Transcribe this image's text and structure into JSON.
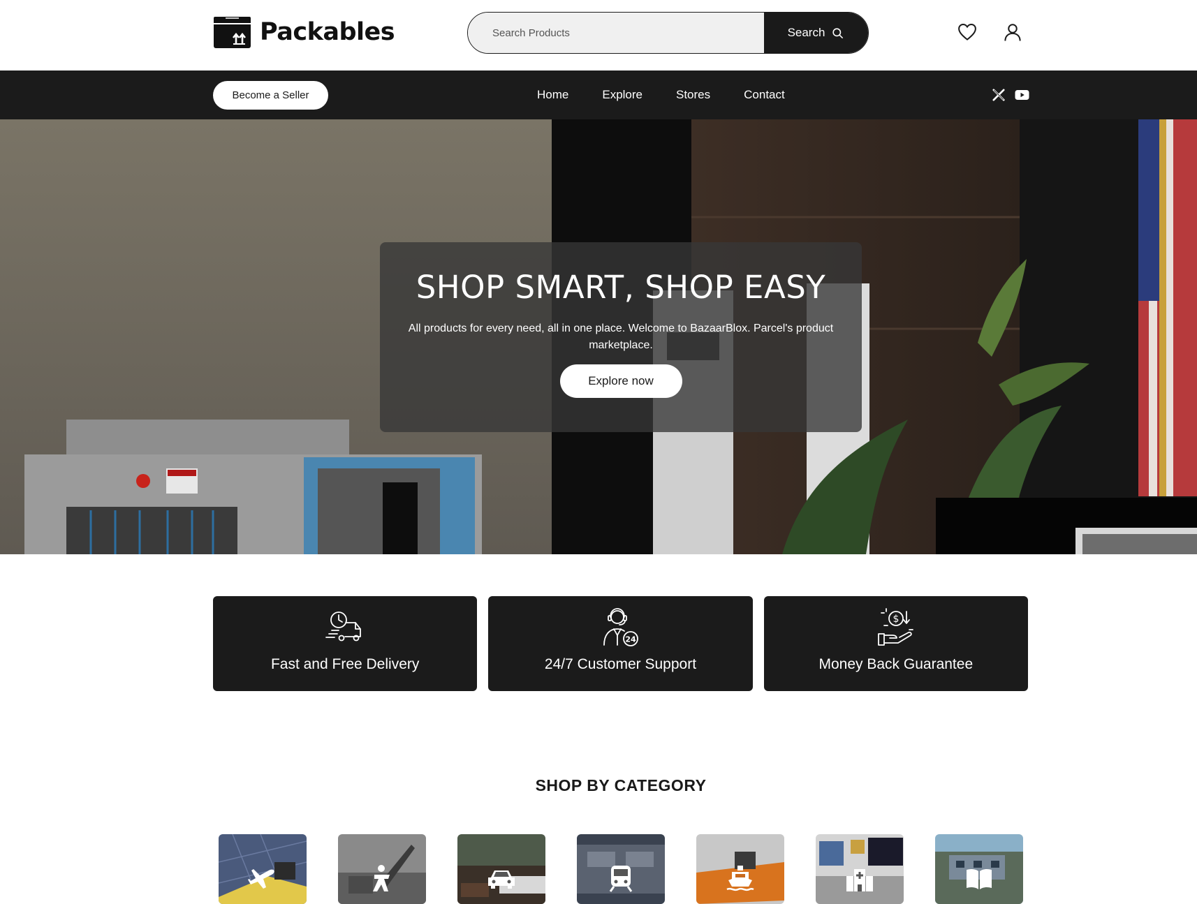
{
  "brand": {
    "name": "Packables"
  },
  "search": {
    "placeholder": "Search Products",
    "button_label": "Search"
  },
  "header_icons": [
    "heart-icon",
    "user-icon"
  ],
  "navbar": {
    "seller_button": "Become a Seller",
    "links": [
      "Home",
      "Explore",
      "Stores",
      "Contact"
    ],
    "social": [
      "x-icon",
      "youtube-icon"
    ]
  },
  "hero": {
    "title": "SHOP SMART, SHOP EASY",
    "subtitle": "All products for every need, all in one place. Welcome to BazaarBlox. Parcel's product marketplace.",
    "cta": "Explore now"
  },
  "features": [
    {
      "label": "Fast and Free Delivery",
      "icon": "delivery-truck-icon"
    },
    {
      "label": "24/7 Customer Support",
      "icon": "customer-support-icon"
    },
    {
      "label": "Money Back Guarantee",
      "icon": "money-back-icon"
    }
  ],
  "categories": {
    "heading": "SHOP BY CATEGORY",
    "items": [
      {
        "icon": "airplane-icon"
      },
      {
        "icon": "soldier-icon"
      },
      {
        "icon": "car-icon"
      },
      {
        "icon": "train-icon"
      },
      {
        "icon": "ship-icon"
      },
      {
        "icon": "hospital-icon"
      },
      {
        "icon": "book-icon"
      }
    ]
  }
}
